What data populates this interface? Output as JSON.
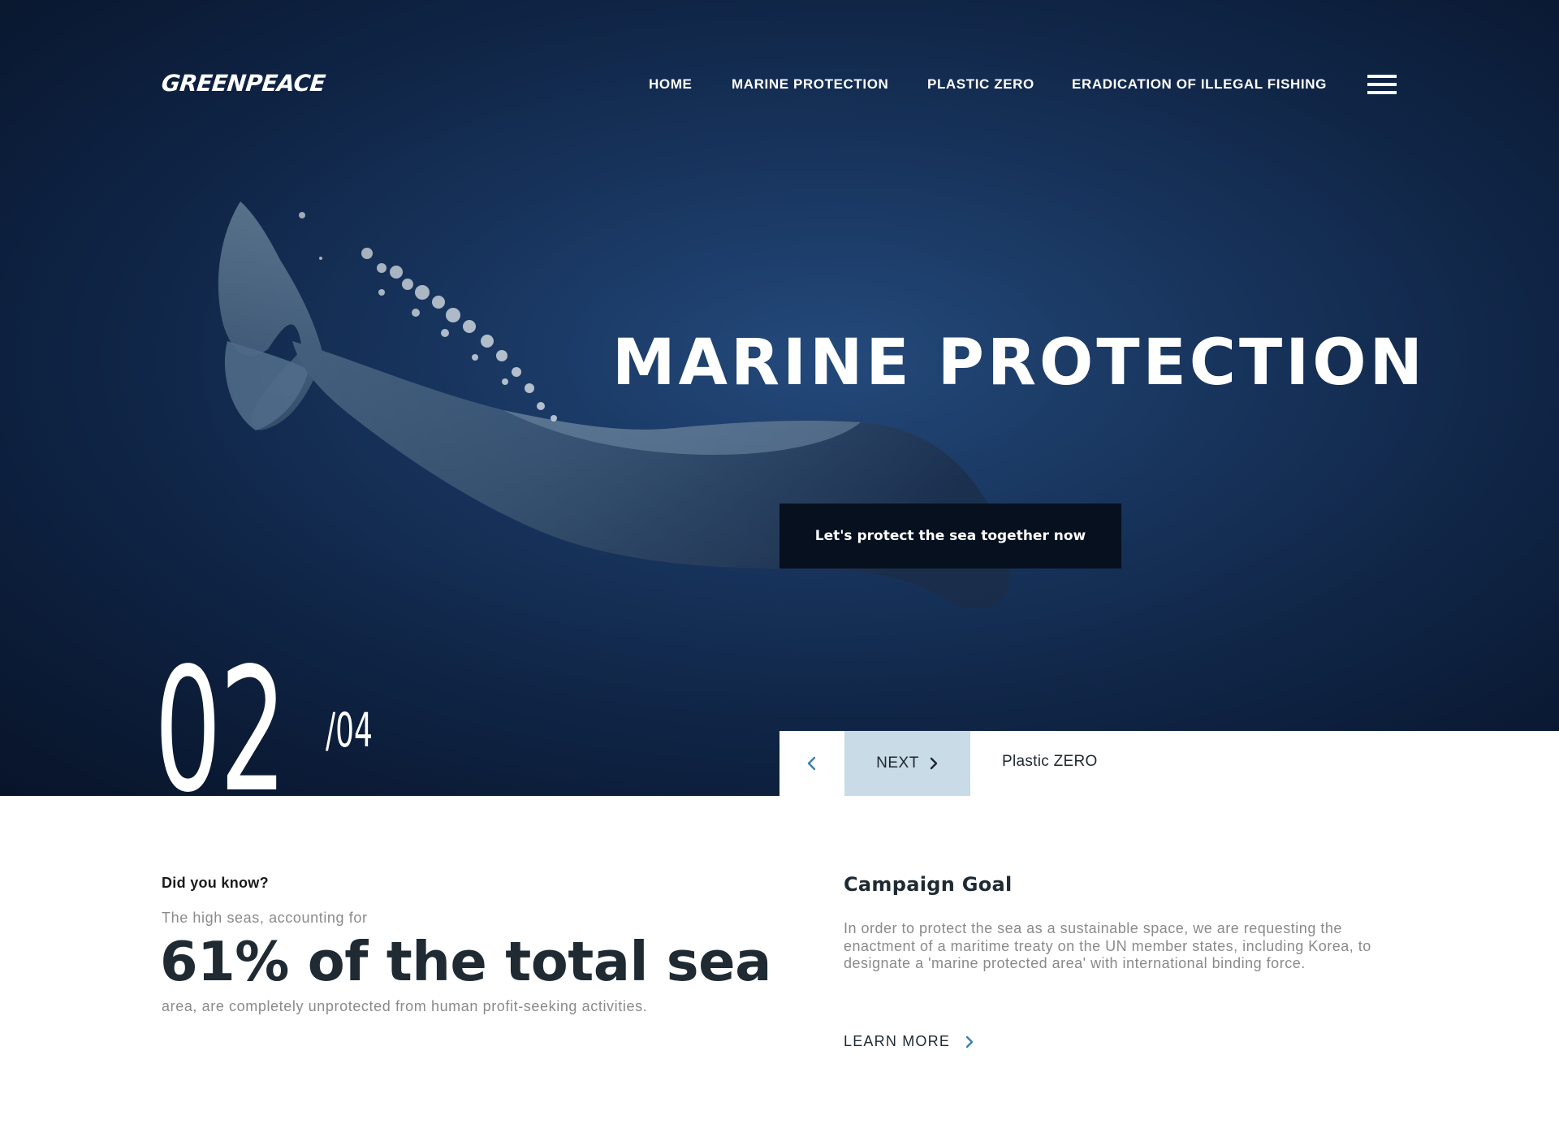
{
  "colors": {
    "hero_bg": "#1a3a68",
    "cta_bg": "#07101e",
    "next_bg": "#c8dbe6",
    "accent_arrow": "#3a7fb0",
    "text_dark": "#1f2a33",
    "text_muted": "#8a8a8a"
  },
  "header": {
    "logo": "GREENPEACE",
    "nav": [
      {
        "label": "HOME"
      },
      {
        "label": "MARINE PROTECTION"
      },
      {
        "label": "PLASTIC ZERO"
      },
      {
        "label": "ERADICATION OF ILLEGAL FISHING"
      }
    ],
    "menu_icon": "hamburger-icon"
  },
  "hero": {
    "title": "MARINE PROTECTION",
    "cta_label": "Let's protect the sea together now",
    "image": "sperm-whale-underwater"
  },
  "slider": {
    "current": "02",
    "total": "/04",
    "prev_icon": "chevron-left-icon",
    "next_label": "NEXT",
    "next_icon": "chevron-right-icon",
    "next_caption": "Plastic ZERO"
  },
  "fact": {
    "heading": "Did you know?",
    "lead": "The high seas, accounting for",
    "stat": "61% of the total sea",
    "tail": "area, are completely unprotected from human profit-seeking activities."
  },
  "goal": {
    "heading": "Campaign Goal",
    "body": "In order to protect the sea as a sustainable space, we are requesting the enactment of a maritime treaty on the UN member states, including Korea, to designate a 'marine protected area' with international binding force.",
    "learn_more_label": "LEARN MORE",
    "learn_more_icon": "chevron-right-icon"
  }
}
